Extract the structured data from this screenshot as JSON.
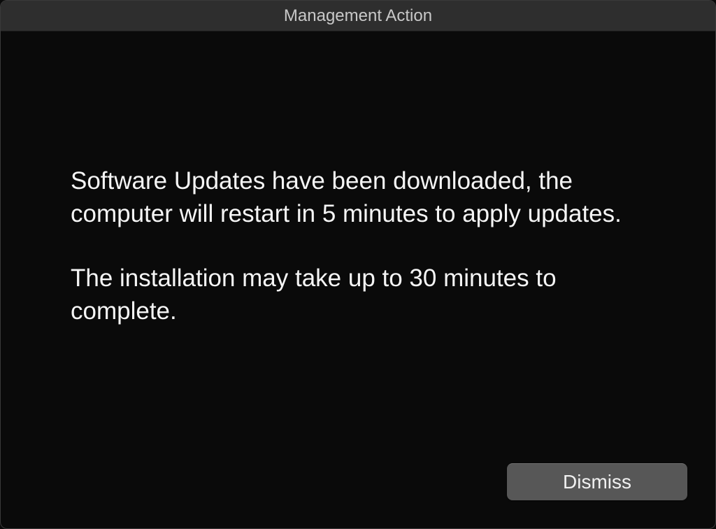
{
  "window": {
    "title": "Management Action"
  },
  "message": {
    "paragraph1": "Software Updates have been downloaded, the computer will restart in 5 minutes to apply updates.",
    "paragraph2": "The installation may take up to 30 minutes to complete."
  },
  "footer": {
    "dismiss_label": "Dismiss"
  }
}
